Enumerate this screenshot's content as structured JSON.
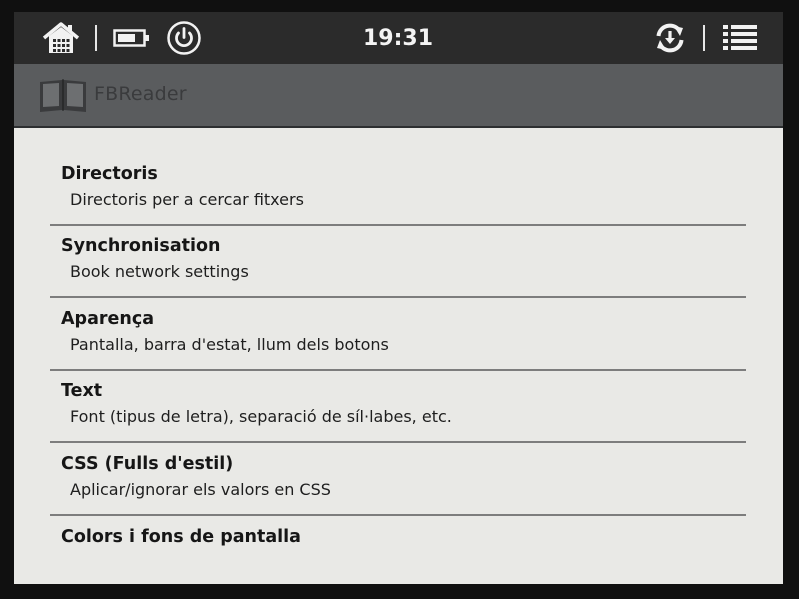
{
  "status_bar": {
    "time": "19:31",
    "icons": [
      "home-icon",
      "battery-icon",
      "power-icon",
      "sync-icon",
      "menu-icon"
    ]
  },
  "app": {
    "title": "FBReader",
    "icon": "book-icon"
  },
  "settings": {
    "items": [
      {
        "title": "Directoris",
        "subtitle": "Directoris per a cercar fitxers"
      },
      {
        "title": "Synchronisation",
        "subtitle": "Book network settings"
      },
      {
        "title": "Aparença",
        "subtitle": "Pantalla, barra d'estat, llum dels botons"
      },
      {
        "title": "Text",
        "subtitle": "Font (tipus de letra), separació de síl·labes, etc."
      },
      {
        "title": "CSS (Fulls d'estil)",
        "subtitle": "Aplicar/ignorar els valors en CSS"
      },
      {
        "title": "Colors i fons de pantalla"
      }
    ]
  },
  "colors": {
    "status_bar_bg": "#2b2b2b",
    "title_bar_bg": "#5a5c5e",
    "screen_bg": "#e9e9e6",
    "divider": "#7d7d7d",
    "text": "#161616"
  }
}
